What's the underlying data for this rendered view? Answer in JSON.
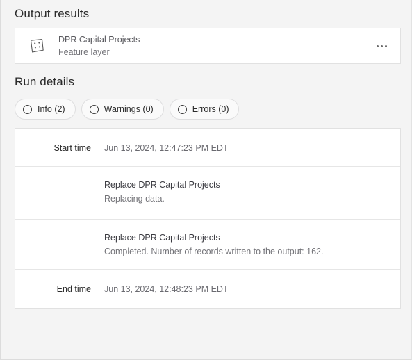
{
  "output": {
    "heading": "Output results",
    "layer": {
      "icon": "feature-layer-icon",
      "title": "DPR Capital Projects",
      "subtitle": "Feature layer",
      "more_label": "..."
    }
  },
  "run_details": {
    "heading": "Run details",
    "filters": [
      {
        "icon": "circle-icon",
        "label": "Info (2)"
      },
      {
        "icon": "circle-icon",
        "label": "Warnings (0)"
      },
      {
        "icon": "circle-icon",
        "label": "Errors (0)"
      }
    ],
    "rows": [
      {
        "type": "time",
        "label": "Start time",
        "value": "Jun 13, 2024, 12:47:23 PM EDT"
      },
      {
        "type": "message",
        "title": "Replace DPR Capital Projects",
        "body": "Replacing data."
      },
      {
        "type": "message",
        "title": "Replace DPR Capital Projects",
        "body": "Completed. Number of records written to the output: 162."
      },
      {
        "type": "time",
        "label": "End time",
        "value": "Jun 13, 2024, 12:48:23 PM EDT"
      }
    ]
  },
  "colors": {
    "page_background": "#f4f4f4",
    "card_background": "#ffffff",
    "border": "#e1e1e1",
    "heading_text": "#2b2b2b",
    "muted_text": "#737378"
  }
}
